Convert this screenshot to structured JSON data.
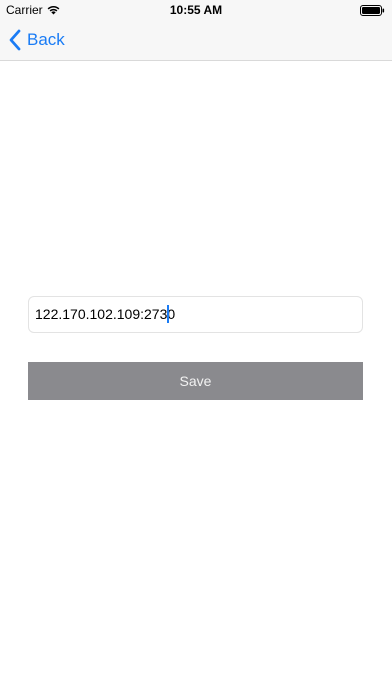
{
  "status_bar": {
    "carrier": "Carrier",
    "time": "10:55 AM",
    "wifi_icon": "wifi-icon",
    "battery_icon": "battery-icon"
  },
  "nav_bar": {
    "back_label": "Back",
    "back_icon": "chevron-left-icon"
  },
  "form": {
    "server_value": "122.170.102.109:2730",
    "save_label": "Save"
  },
  "colors": {
    "accent": "#1a7cf5",
    "save_button_bg": "#8a8a8e",
    "nav_bg": "#f7f7f7"
  }
}
